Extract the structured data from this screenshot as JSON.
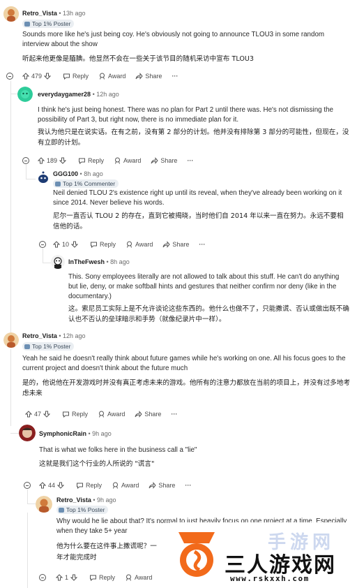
{
  "comments": [
    {
      "username": "Retro_Vista",
      "time": "13h ago",
      "badge": "Top 1% Poster",
      "text": "Sounds more like he's just being coy. He's obviously not going to announce TLOU3 in some random interview about the show",
      "translation": "听起来他更像是腼腆。他显然不会在一些关于该节目的随机采访中宣布 TLOU3",
      "votes": "479",
      "reply": "Reply",
      "award": "Award",
      "share": "Share"
    },
    {
      "username": "everydaygamer28",
      "time": "12h ago",
      "text": "I think he's just being honest. There was no plan for Part 2 until there was. He's not dismissing the possibility of Part 3, but right now, there is no immediate plan for it.",
      "translation": "我认为他只是在说实话。在有之前，没有第 2 部分的计划。他并没有排除第 3 部分的可能性，但现在，没有立即的计划。",
      "votes": "189",
      "reply": "Reply",
      "award": "Award",
      "share": "Share"
    },
    {
      "username": "GGG100",
      "time": "8h ago",
      "badge": "Top 1% Commenter",
      "text": "Neil denied TLOU 2's existence right up until its reveal, when they've already been working on it since 2014. Never believe his words.",
      "translation": "尼尔一直否认 TLOU 2 的存在，直到它被揭晓，当时他们自 2014 年以来一直在努力。永远不要相信他的话。",
      "votes": "10",
      "reply": "Reply",
      "award": "Award",
      "share": "Share"
    },
    {
      "username": "InTheFwesh",
      "time": "8h ago",
      "text": "This. Sony employees literally are not allowed to talk about this stuff. He can't do anything but lie, deny, or make softball hints and gestures that neither confirm nor deny (like in the documentary.)",
      "translation": "这。索尼员工实际上是不允许谈论这些东西的。他什么也做不了，只能撒谎、否认或做出既不确认也不否认的垒球暗示和手势（就像纪录片中一样）。"
    },
    {
      "username": "Retro_Vista",
      "time": "12h ago",
      "badge": "Top 1% Poster",
      "text": "Yeah he said he doesn't really think about future games while he's working on one. All his focus goes to the current project and doesn't think about the future much",
      "translation": "是的，他说他在开发游戏时并没有真正考虑未来的游戏。他所有的注意力都放在当前的项目上，并没有过多地考虑未来",
      "votes": "47",
      "reply": "Reply",
      "award": "Award",
      "share": "Share"
    },
    {
      "username": "SymphonicRain",
      "time": "9h ago",
      "text": "That is what we folks here in the business call a \"lie\"",
      "translation": "这就是我们这个行业的人所说的 \"谎言\"",
      "votes": "44",
      "reply": "Reply",
      "award": "Award",
      "share": "Share"
    },
    {
      "username": "Retro_Vista",
      "time": "9h ago",
      "badge": "Top 1% Poster",
      "text": "Why would he lie about that? It's normal to just heavily focus on one project at a time. Especially when they take 5+ year",
      "translation": "他为什么要在这件事上撒谎呢？一",
      "translation2": "年才能完成时",
      "votes": "1",
      "reply": "Reply",
      "award": "Award"
    }
  ],
  "watermark": {
    "brand": "三人游戏网",
    "url": "www.rskxxh.com",
    "faded": "手游网"
  },
  "colors": {
    "accent": "#0079d3",
    "badge_bg": "#eaeef2",
    "thread_line": "#e3e3e3",
    "watermark_orange": "#f26a1b"
  }
}
